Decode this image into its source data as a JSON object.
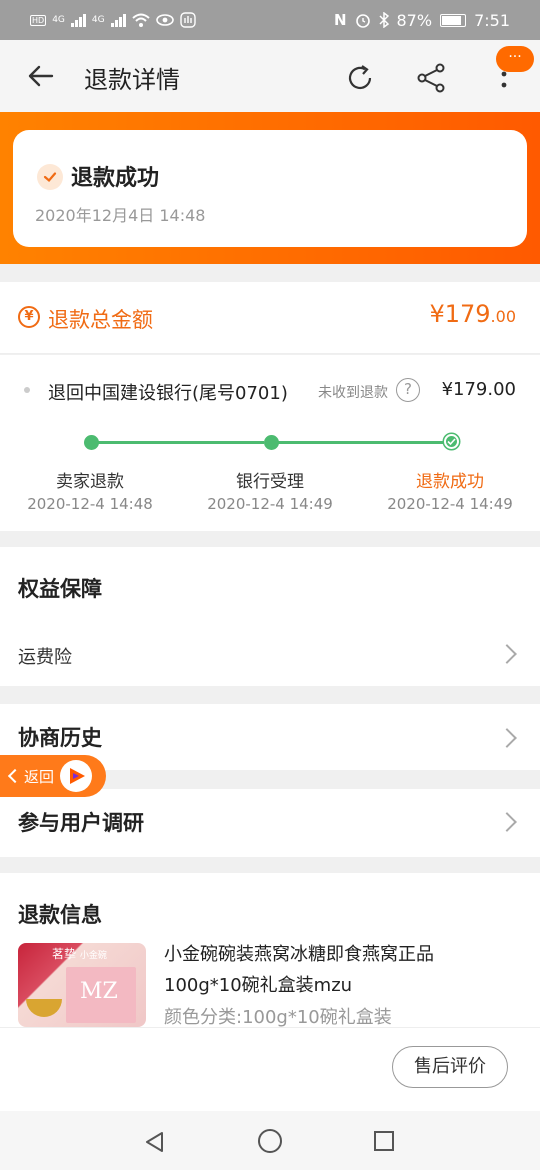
{
  "status_bar": {
    "net1": "4G",
    "net2": "4G",
    "nfc": "N",
    "battery": "87%",
    "time": "7:51"
  },
  "navbar": {
    "title": "退款详情",
    "badge": "···"
  },
  "refund_status": {
    "title": "退款成功",
    "time": "2020年12月4日 14:48"
  },
  "total": {
    "icon": "¥",
    "label": "退款总金额",
    "currency": "¥",
    "amount_int": "179",
    "amount_dec": ".00"
  },
  "refund_route": {
    "bank": "退回中国建设银行(尾号0701)",
    "not_received": "未收到退款",
    "help": "?",
    "amount": "¥179.00",
    "steps": [
      {
        "label": "卖家退款",
        "time": "2020-12-4 14:48"
      },
      {
        "label": "银行受理",
        "time": "2020-12-4 14:49"
      },
      {
        "label": "退款成功",
        "time": "2020-12-4 14:49"
      }
    ]
  },
  "rights": {
    "title": "权益保障",
    "item": "运费险"
  },
  "history": {
    "title": "协商历史"
  },
  "floating_back": {
    "label": "返回"
  },
  "survey": {
    "title": "参与用户调研"
  },
  "refund_info": {
    "title": "退款信息",
    "thumb_brand": "茗挚",
    "thumb_sub": "小金碗",
    "thumb_mark": "MZ",
    "product_title": "小金碗碗装燕窝冰糖即食燕窝正品100g*10碗礼盒装mzu",
    "spec": "颜色分类:100g*10碗礼盒装"
  },
  "bottom": {
    "review_button": "售后评价"
  },
  "colors": {
    "accent": "#f06b14",
    "success": "#4cbb70",
    "banner_start": "#ff8200",
    "banner_end": "#ff5a00"
  }
}
